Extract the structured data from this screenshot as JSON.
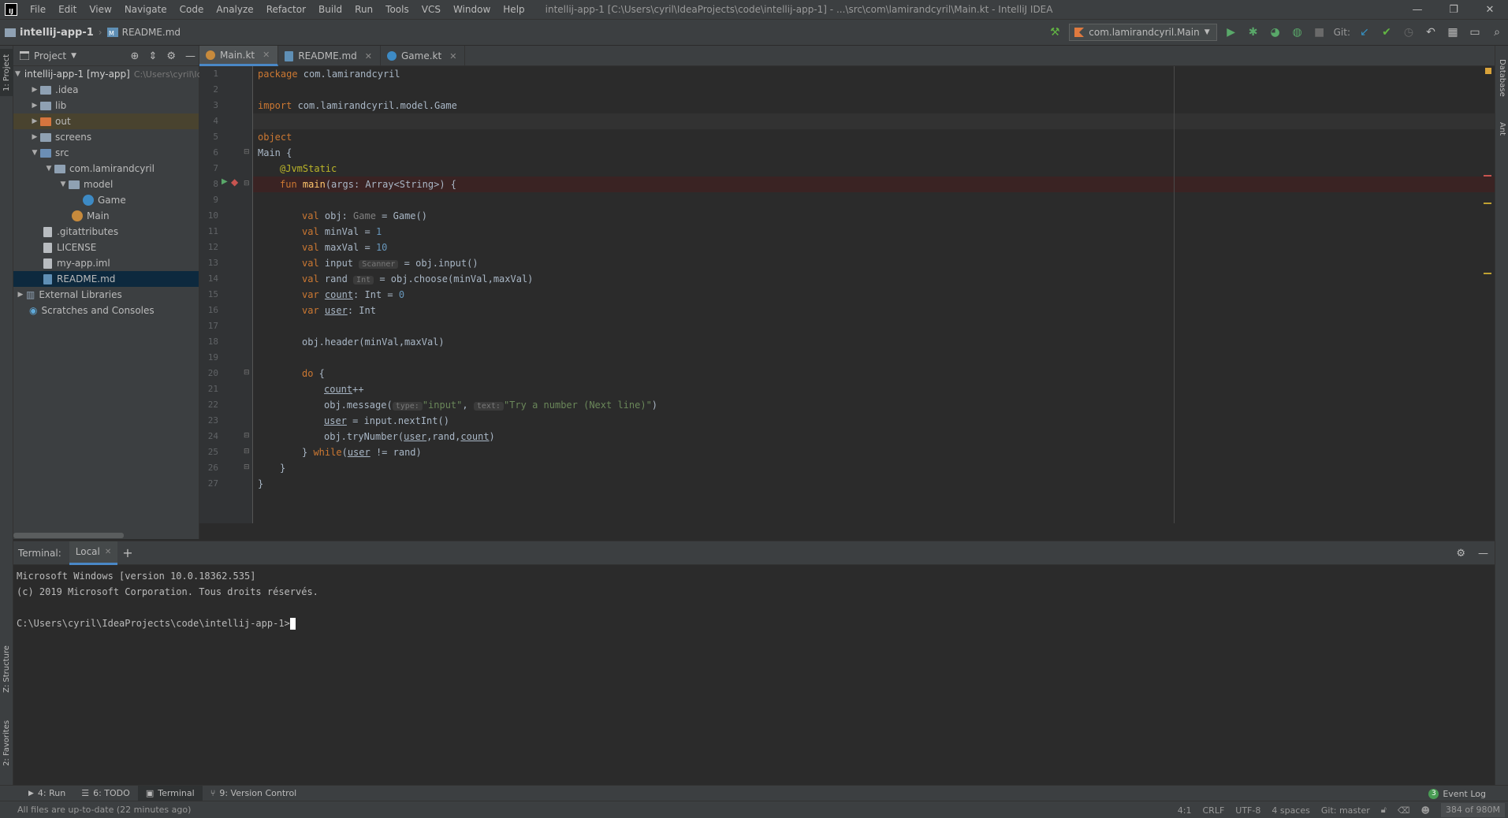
{
  "menubar": {
    "logo": "IJ",
    "items": [
      "File",
      "Edit",
      "View",
      "Navigate",
      "Code",
      "Analyze",
      "Refactor",
      "Build",
      "Run",
      "Tools",
      "VCS",
      "Window",
      "Help"
    ],
    "window_title": "intellij-app-1 [C:\\Users\\cyril\\IdeaProjects\\code\\intellij-app-1] - ...\\src\\com\\lamirandcyril\\Main.kt - IntelliJ IDEA",
    "minimize": "—",
    "restore": "❐",
    "close": "✕"
  },
  "navbar": {
    "project": "intellij-app-1",
    "file": "README.md",
    "run_config": "com.lamirandcyril.Main",
    "git_label": "Git:"
  },
  "left_strip": {
    "project_tab": "1: Project",
    "structure_tab": "Z: Structure",
    "favorites_tab": "2: Favorites"
  },
  "right_strip": {
    "database_tab": "Database",
    "ant_tab": "Ant"
  },
  "project_panel": {
    "title": "Project",
    "tree": [
      {
        "label": "intellij-app-1 [my-app]",
        "extra": "C:\\Users\\cyril\\Ic",
        "type": "module",
        "depth": 0,
        "expanded": true
      },
      {
        "label": ".idea",
        "type": "folder",
        "depth": 1,
        "expanded": false
      },
      {
        "label": "lib",
        "type": "folder",
        "depth": 1,
        "expanded": false
      },
      {
        "label": "out",
        "type": "folder-orange",
        "depth": 1,
        "expanded": false
      },
      {
        "label": "screens",
        "type": "folder",
        "depth": 1,
        "expanded": false
      },
      {
        "label": "src",
        "type": "folder",
        "depth": 1,
        "expanded": true
      },
      {
        "label": "com.lamirandcyril",
        "type": "package",
        "depth": 2,
        "expanded": true
      },
      {
        "label": "model",
        "type": "package",
        "depth": 3,
        "expanded": true
      },
      {
        "label": "Game",
        "type": "kt-class",
        "depth": 4
      },
      {
        "label": "Main",
        "type": "kt-object",
        "depth": 3
      },
      {
        "label": ".gitattributes",
        "type": "file",
        "depth": 1
      },
      {
        "label": "LICENSE",
        "type": "file",
        "depth": 1
      },
      {
        "label": "my-app.iml",
        "type": "file",
        "depth": 1
      },
      {
        "label": "README.md",
        "type": "md",
        "depth": 1
      },
      {
        "label": "External Libraries",
        "type": "libs",
        "depth": 0,
        "expanded": false
      },
      {
        "label": "Scratches and Consoles",
        "type": "scratch",
        "depth": 0
      }
    ]
  },
  "editor_tabs": [
    {
      "label": "Main.kt",
      "active": true
    },
    {
      "label": "README.md",
      "active": false
    },
    {
      "label": "Game.kt",
      "active": false
    }
  ],
  "editor": {
    "line_numbers": [
      "1",
      "2",
      "3",
      "4",
      "5",
      "6",
      "7",
      "8",
      "9",
      "10",
      "11",
      "12",
      "13",
      "14",
      "15",
      "16",
      "17",
      "18",
      "19",
      "20",
      "21",
      "22",
      "23",
      "24",
      "25",
      "26",
      "27"
    ],
    "hints": {
      "scanner": "Scanner",
      "int": "Int",
      "type": "type:",
      "text": "text:"
    },
    "tokens": {
      "package_kw": "package",
      "package_name": " com.lamirandcyril",
      "import_kw": "import",
      "import_name": " com.lamirandcyril.model.Game",
      "object_kw": "object",
      "main_obj": "Main {",
      "jvmstatic": "@JvmStatic",
      "fun_kw": "fun",
      "main_fn": "main",
      "main_sig": "(args: Array<String>) {",
      "val_kw": "val",
      "var_kw": "var",
      "obj_decl": " obj: ",
      "game_type": "Game",
      "game_init": " = Game()",
      "minval_decl": " minVal = ",
      "one": "1",
      "maxval_decl": " maxVal = ",
      "ten": "10",
      "input_decl": " input ",
      "input_init": " = obj.input()",
      "rand_decl": " rand ",
      "rand_init": " = obj.choose(minVal,maxVal)",
      "count_name": "count",
      "count_type": ": Int = ",
      "zero": "0",
      "user_name": "user",
      "user_type": ": Int",
      "header_call": "obj.header(minVal,maxVal)",
      "do_kw": "do",
      "do_brace": " {",
      "count_inc": "++",
      "message_call": "obj.message(",
      "input_str": "\"input\"",
      "comma": ", ",
      "try_str": "\"Try a number (Next line)\"",
      "close_paren": ")",
      "user_assign": " = input.nextInt()",
      "trynumber_call": "obj.tryNumber(",
      "rand_arg": ",rand,",
      "while_close": "} ",
      "while_kw": "while",
      "while_open": "(",
      "while_cond": " != rand)",
      "close_inner": "}",
      "close_outer": "}"
    }
  },
  "terminal": {
    "label": "Terminal:",
    "tab": "Local",
    "lines": [
      "Microsoft Windows [version 10.0.18362.535]",
      "(c) 2019 Microsoft Corporation. Tous droits réservés.",
      "",
      "C:\\Users\\cyril\\IdeaProjects\\code\\intellij-app-1>"
    ]
  },
  "tool_windows": [
    {
      "label": "4: Run",
      "icon": "run-icon"
    },
    {
      "label": "6: TODO",
      "icon": "todo-icon"
    },
    {
      "label": "Terminal",
      "icon": "terminal-icon",
      "active": true
    },
    {
      "label": "9: Version Control",
      "icon": "vcs-icon"
    }
  ],
  "event_log": {
    "count": "3",
    "label": "Event Log"
  },
  "statusbar": {
    "message": "All files are up-to-date (22 minutes ago)",
    "position": "4:1",
    "line_sep": "CRLF",
    "encoding": "UTF-8",
    "indent": "4 spaces",
    "git": "Git: master",
    "memory": "384 of 980M"
  },
  "colors": {
    "bg": "#2b2b2b",
    "panel": "#3c3f41",
    "keyword": "#cc7832",
    "annotation": "#bbb529",
    "function": "#ffc66d",
    "number": "#6897bb",
    "string": "#6a8759",
    "accent": "#4a88c7"
  }
}
